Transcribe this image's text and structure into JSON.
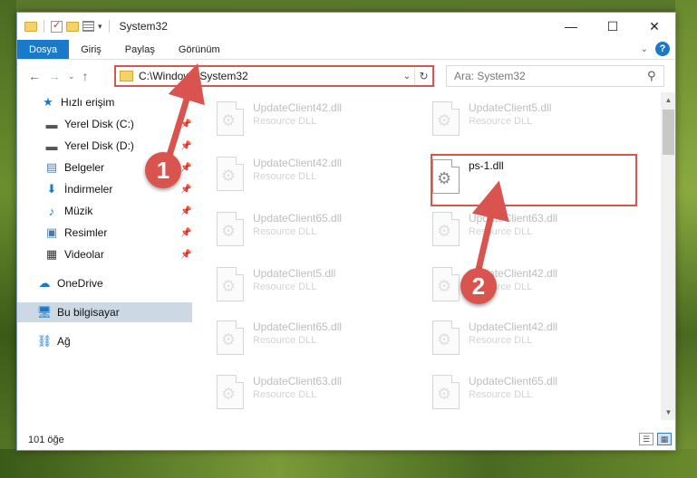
{
  "window": {
    "title": "System32",
    "controls": {
      "minimize": "—",
      "maximize": "☐",
      "close": "✕"
    }
  },
  "ribbon": {
    "tabs": [
      "Dosya",
      "Giriş",
      "Paylaş",
      "Görünüm"
    ],
    "help": "?"
  },
  "address": {
    "path": "C:\\Windows\\System32",
    "search_placeholder": "Ara: System32"
  },
  "nav_pane": {
    "items": [
      {
        "label": "Hızlı erişim",
        "icon": "star-icon"
      },
      {
        "label": "Yerel Disk (C:)",
        "icon": "drive-icon",
        "pinned": true
      },
      {
        "label": "Yerel Disk (D:)",
        "icon": "drive-icon",
        "pinned": true
      },
      {
        "label": "Belgeler",
        "icon": "documents-icon",
        "pinned": true
      },
      {
        "label": "İndirmeler",
        "icon": "download-icon",
        "pinned": true
      },
      {
        "label": "Müzik",
        "icon": "music-icon",
        "pinned": true
      },
      {
        "label": "Resimler",
        "icon": "pictures-icon",
        "pinned": true
      },
      {
        "label": "Videolar",
        "icon": "videos-icon",
        "pinned": true
      },
      {
        "label": "OneDrive",
        "icon": "cloud-icon"
      },
      {
        "label": "Bu bilgisayar",
        "icon": "computer-icon",
        "selected": true
      },
      {
        "label": "Ağ",
        "icon": "network-icon"
      }
    ]
  },
  "files": [
    {
      "name": "UpdateClient42.dll",
      "type": "Resource DLL"
    },
    {
      "name": "UpdateClient5.dll",
      "type": "Resource DLL"
    },
    {
      "name": "UpdateClient42.dll",
      "type": "Resource DLL"
    },
    {
      "name": "ps-1.dll",
      "type": ""
    },
    {
      "name": "UpdateClient65.dll",
      "type": "Resource DLL"
    },
    {
      "name": "UpdateClient63.dll",
      "type": "Resource DLL"
    },
    {
      "name": "UpdateClient5.dll",
      "type": "Resource DLL"
    },
    {
      "name": "UpdateClient42.dll",
      "type": "Resource DLL"
    },
    {
      "name": "UpdateClient65.dll",
      "type": "Resource DLL"
    },
    {
      "name": "UpdateClient42.dll",
      "type": "Resource DLL"
    },
    {
      "name": "UpdateClient63.dll",
      "type": "Resource DLL"
    },
    {
      "name": "UpdateClient65.dll",
      "type": "Resource DLL"
    }
  ],
  "status": {
    "count": "101 öğe"
  },
  "annotations": {
    "step1": "1",
    "step2": "2"
  },
  "colors": {
    "accent": "#1979ca",
    "highlight": "#d9534f"
  }
}
